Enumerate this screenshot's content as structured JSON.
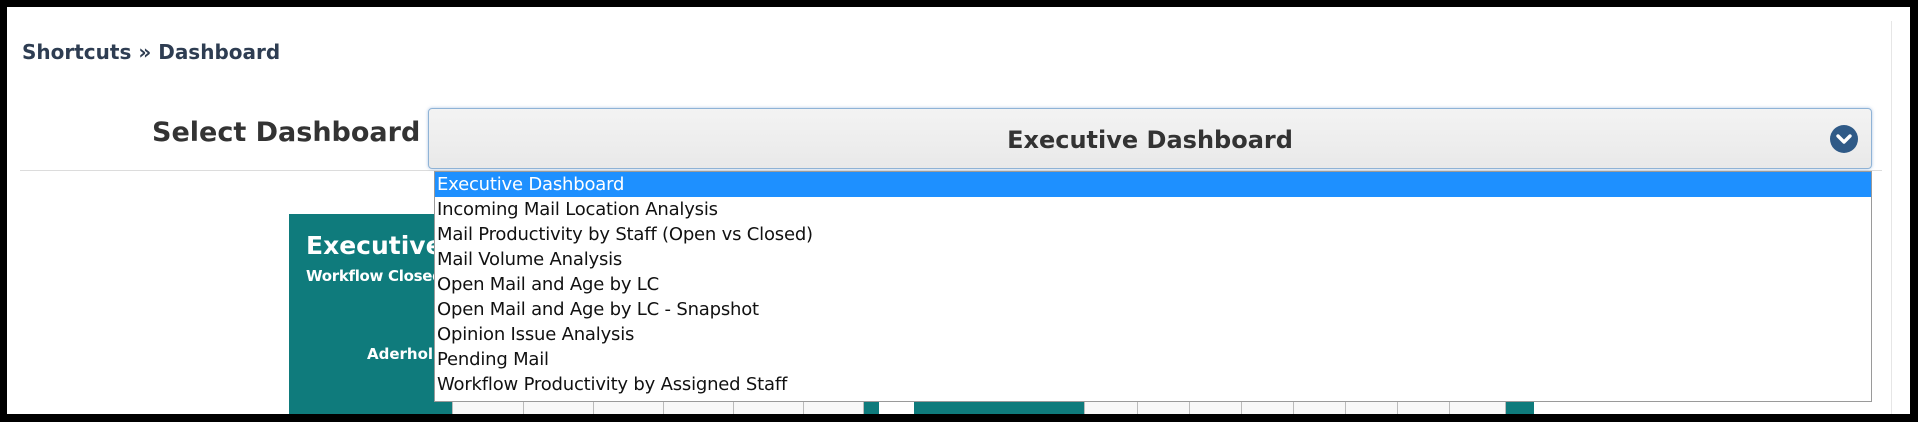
{
  "breadcrumb": {
    "text": "Shortcuts » Dashboard"
  },
  "select": {
    "label": "Select Dashboard",
    "value": "Executive Dashboard",
    "icon": "chevron-down-icon",
    "options": [
      "Executive Dashboard",
      "Incoming Mail Location Analysis",
      "Mail Productivity by Staff (Open vs Closed)",
      "Mail Volume Analysis",
      "Open Mail and Age by LC",
      "Open Mail and Age by LC - Snapshot",
      "Opinion Issue Analysis",
      "Pending Mail",
      "Workflow Productivity by Assigned Staff"
    ],
    "selected_index": 0
  },
  "background_panel": {
    "title": "Executive D",
    "subtitle": "Workflow Closed",
    "row_label": "Aderhol"
  },
  "colors": {
    "panel": "#0f7b7c",
    "selection": "#1e90ff",
    "breadcrumb": "#2e3d52",
    "chevron_bg": "#2f5a87"
  }
}
